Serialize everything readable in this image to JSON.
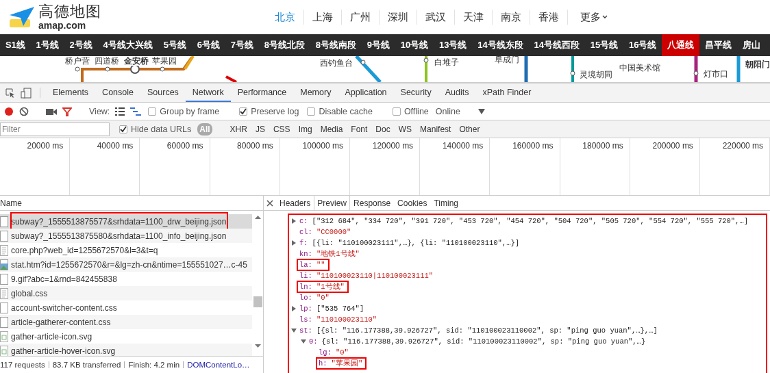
{
  "site": {
    "logo_title": "高德地图",
    "logo_subtitle": "amap.com",
    "cities": [
      {
        "label": "北京",
        "selected": true
      },
      {
        "label": "上海",
        "selected": false
      },
      {
        "label": "广州",
        "selected": false
      },
      {
        "label": "深圳",
        "selected": false
      },
      {
        "label": "武汉",
        "selected": false
      },
      {
        "label": "天津",
        "selected": false
      },
      {
        "label": "南京",
        "selected": false
      },
      {
        "label": "香港",
        "selected": false
      }
    ],
    "more": "更多",
    "lines": [
      {
        "label": "S1线",
        "selected": false
      },
      {
        "label": "1号线",
        "selected": false
      },
      {
        "label": "2号线",
        "selected": false
      },
      {
        "label": "4号线大兴线",
        "selected": false
      },
      {
        "label": "5号线",
        "selected": false
      },
      {
        "label": "6号线",
        "selected": false
      },
      {
        "label": "7号线",
        "selected": false
      },
      {
        "label": "8号线北段",
        "selected": false
      },
      {
        "label": "8号线南段",
        "selected": false
      },
      {
        "label": "9号线",
        "selected": false
      },
      {
        "label": "10号线",
        "selected": false
      },
      {
        "label": "13号线",
        "selected": false
      },
      {
        "label": "14号线东段",
        "selected": false
      },
      {
        "label": "14号线西段",
        "selected": false
      },
      {
        "label": "15号线",
        "selected": false
      },
      {
        "label": "16号线",
        "selected": false
      },
      {
        "label": "八通线",
        "selected": true
      },
      {
        "label": "昌平线",
        "selected": false
      },
      {
        "label": "房山",
        "selected": false
      }
    ],
    "stations": [
      "桥户营",
      "四道桥",
      "金安桥",
      "苹果园",
      "西钓鱼台",
      "白堆子",
      "阜成门",
      "灵境胡同",
      "中国美术馆",
      "灯市口",
      "朝阳门"
    ]
  },
  "devtools": {
    "tabs": [
      {
        "label": "Elements",
        "selected": false
      },
      {
        "label": "Console",
        "selected": false
      },
      {
        "label": "Sources",
        "selected": false
      },
      {
        "label": "Network",
        "selected": true
      },
      {
        "label": "Performance",
        "selected": false
      },
      {
        "label": "Memory",
        "selected": false
      },
      {
        "label": "Application",
        "selected": false
      },
      {
        "label": "Security",
        "selected": false
      },
      {
        "label": "Audits",
        "selected": false
      },
      {
        "label": "xPath Finder",
        "selected": false
      }
    ],
    "toolbar": {
      "recording": true,
      "filter_active": true,
      "view_label": "View:",
      "checkboxes": [
        {
          "label": "Group by frame",
          "checked": false
        },
        {
          "label": "Preserve log",
          "checked": true
        },
        {
          "label": "Disable cache",
          "checked": false
        }
      ],
      "offline": {
        "label": "Offline",
        "checked": false
      },
      "throttle": "Online"
    },
    "filter": {
      "placeholder": "Filter",
      "hide_data_urls": {
        "label": "Hide data URLs",
        "checked": true
      },
      "types": [
        {
          "label": "All",
          "selected": true
        },
        {
          "label": "XHR",
          "selected": false
        },
        {
          "label": "JS",
          "selected": false
        },
        {
          "label": "CSS",
          "selected": false
        },
        {
          "label": "Img",
          "selected": false
        },
        {
          "label": "Media",
          "selected": false
        },
        {
          "label": "Font",
          "selected": false
        },
        {
          "label": "Doc",
          "selected": false
        },
        {
          "label": "WS",
          "selected": false
        },
        {
          "label": "Manifest",
          "selected": false
        },
        {
          "label": "Other",
          "selected": false
        }
      ]
    },
    "timeline": [
      "20000 ms",
      "40000 ms",
      "60000 ms",
      "80000 ms",
      "100000 ms",
      "120000 ms",
      "140000 ms",
      "160000 ms",
      "180000 ms",
      "200000 ms",
      "220000 ms"
    ],
    "requests": {
      "column": "Name",
      "rows": [
        {
          "name": "subway?_1555513875577&srhdata=1100_drw_beijing.json",
          "kind": "blank",
          "selected": true,
          "highlighted": true
        },
        {
          "name": "subway?_1555513875580&srhdata=1100_info_beijing.json",
          "kind": "blank",
          "selected": false,
          "highlighted": false
        },
        {
          "name": "core.php?web_id=1255672570&l=3&t=q",
          "kind": "doc",
          "selected": false,
          "highlighted": false
        },
        {
          "name": "stat.htm?id=1255672570&r=&lg=zh-cn&ntime=155551027…c-45",
          "kind": "image",
          "selected": false,
          "highlighted": false
        },
        {
          "name": "9.gif?abc=1&rnd=842455838",
          "kind": "blank",
          "selected": false,
          "highlighted": false
        },
        {
          "name": "global.css",
          "kind": "doc",
          "selected": false,
          "highlighted": false
        },
        {
          "name": "account-switcher-content.css",
          "kind": "blank",
          "selected": false,
          "highlighted": false
        },
        {
          "name": "article-gatherer-content.css",
          "kind": "blank",
          "selected": false,
          "highlighted": false
        },
        {
          "name": "gather-article-icon.svg",
          "kind": "svg",
          "selected": false,
          "highlighted": false
        },
        {
          "name": "gather-article-hover-icon.svg",
          "kind": "svg",
          "selected": false,
          "highlighted": false
        }
      ]
    },
    "status": [
      "117 requests",
      "83.7 KB transferred",
      "Finish: 4.2 min",
      "DOMContentLo…"
    ],
    "detail_tabs": [
      {
        "label": "Headers",
        "selected": false
      },
      {
        "label": "Preview",
        "selected": true
      },
      {
        "label": "Response",
        "selected": false
      },
      {
        "label": "Cookies",
        "selected": false
      },
      {
        "label": "Timing",
        "selected": false
      }
    ],
    "preview": {
      "framed": true,
      "lines": [
        {
          "key": "c:",
          "value": "[\"312 684\", \"334 720\", \"391 720\", \"453 720\", \"454 720\", \"504 720\", \"505 720\", \"554 720\", \"555 720\",…]",
          "kind": "summary",
          "expanded": false,
          "highlighted": false
        },
        {
          "key": "cl:",
          "value": "\"CC0000\"",
          "kind": "string",
          "highlighted": false
        },
        {
          "key": "f:",
          "value": "[{li: \"110100023111\",…}, {li: \"110100023110\",…}]",
          "kind": "summary",
          "expanded": false,
          "highlighted": false
        },
        {
          "key": "kn:",
          "value": "\"地铁1号线\"",
          "kind": "string",
          "highlighted": false
        },
        {
          "key": "la:",
          "value": "\"\"",
          "kind": "string",
          "highlighted": true
        },
        {
          "key": "li:",
          "value": "\"110100023110|110100023111\"",
          "kind": "string",
          "highlighted": false
        },
        {
          "key": "ln:",
          "value": "\"1号线\"",
          "kind": "string",
          "highlighted": true
        },
        {
          "key": "lo:",
          "value": "\"0\"",
          "kind": "string",
          "highlighted": false
        },
        {
          "key": "lp:",
          "value": "[\"535 764\"]",
          "kind": "summary",
          "expanded": false,
          "highlighted": false
        },
        {
          "key": "ls:",
          "value": "\"110100023110\"",
          "kind": "string",
          "highlighted": false
        },
        {
          "key": "st:",
          "value": "[{sl: \"116.177388,39.926727\", sid: \"110100023110002\", sp: \"ping guo yuan\",…},…]",
          "kind": "summary",
          "expanded": true,
          "highlighted": false,
          "children": [
            {
              "key": "0:",
              "value": "{sl: \"116.177388,39.926727\", sid: \"110100023110002\", sp: \"ping guo yuan\",…}",
              "kind": "summary",
              "expanded": true,
              "highlighted": false,
              "children": [
                {
                  "key": "lg:",
                  "value": "\"0\"",
                  "kind": "string",
                  "highlighted": false
                },
                {
                  "key": "h:",
                  "value": "\"苹果园\"",
                  "kind": "string",
                  "highlighted": true
                }
              ]
            }
          ]
        }
      ]
    }
  }
}
